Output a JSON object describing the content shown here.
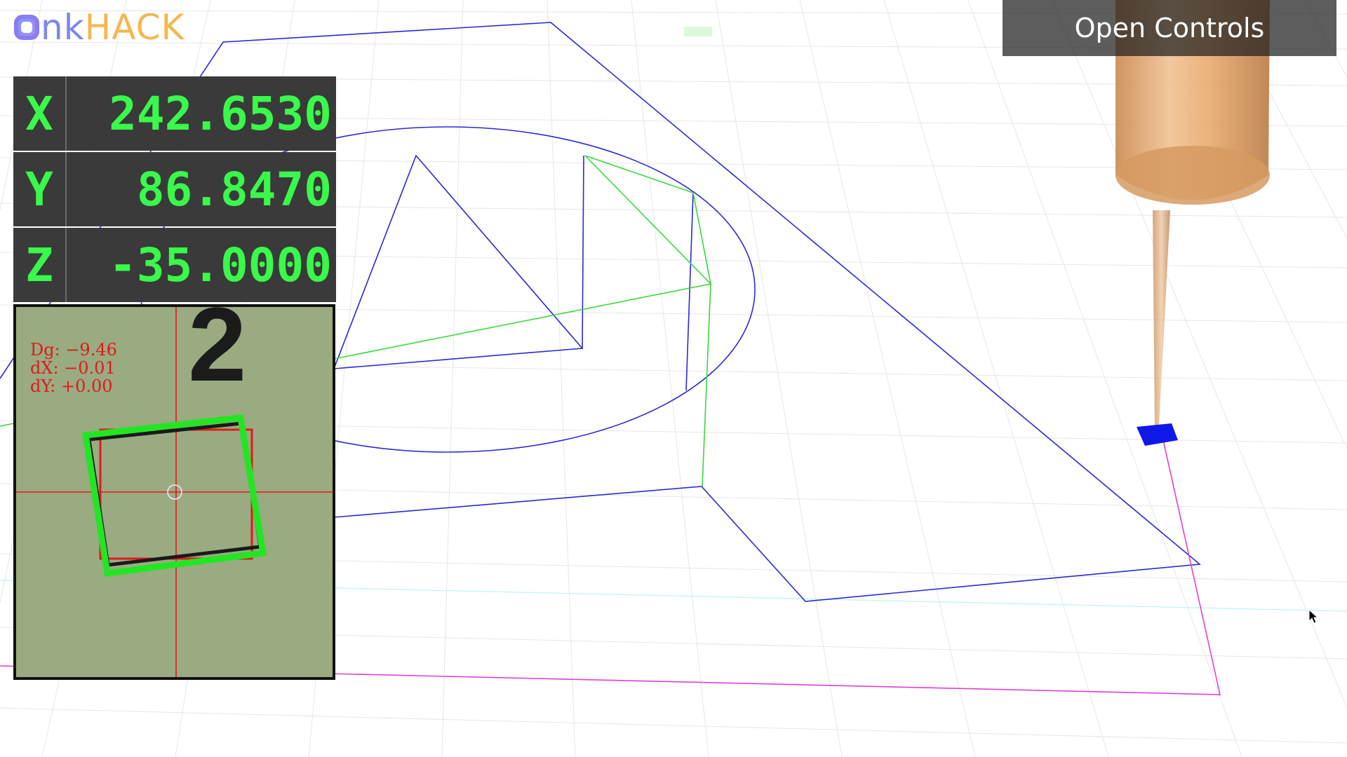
{
  "app": {
    "logo_prefix": "nk",
    "logo_suffix": "HACK"
  },
  "dro": {
    "x_label": "X",
    "x_value": "242.6530",
    "y_label": "Y",
    "y_value": "86.8470",
    "z_label": "Z",
    "z_value": "-35.0000"
  },
  "camera": {
    "digit": "2",
    "dg": "Dg:  −9.46",
    "dx": "dX:  −0.01",
    "dy": "dY:  +0.00"
  },
  "controls": {
    "open_label": "Open Controls"
  },
  "colors": {
    "dro_text": "#39f94a",
    "path_blue": "#2a2ad8",
    "path_green": "#3cd83c",
    "bounds_magenta": "#e040d0",
    "tool_orange": "#e8a060"
  }
}
